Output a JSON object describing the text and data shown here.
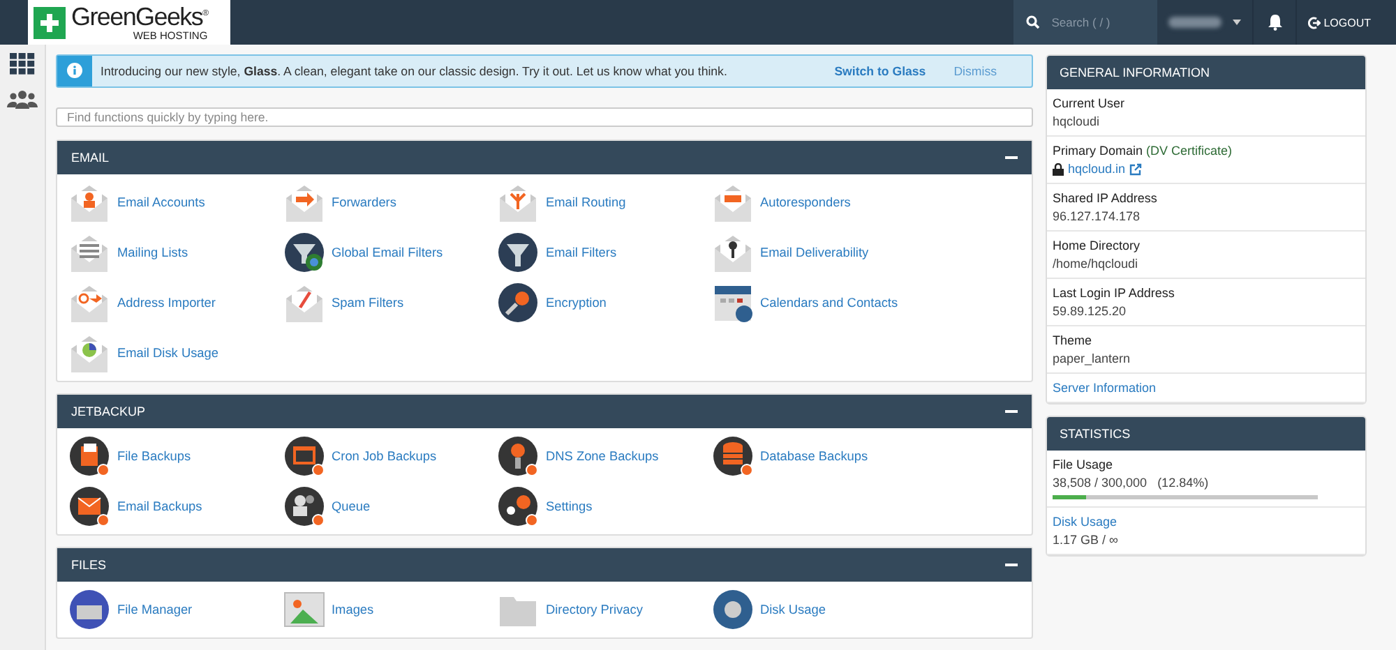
{
  "header": {
    "logo": {
      "name": "GreenGeeks",
      "mark": "®",
      "tagline": "WEB HOSTING"
    },
    "search": {
      "placeholder": "Search ( / )"
    },
    "logout": "LOGOUT"
  },
  "notice": {
    "text": "Introducing our new style, **Glass**. A clean, elegant take on our classic design. Try it out. Let us know what you think.",
    "action": "Switch to Glass",
    "dismiss": "Dismiss"
  },
  "quick_search": {
    "placeholder": "Find functions quickly by typing here."
  },
  "sections": [
    {
      "title": "EMAIL",
      "items": [
        "Email Accounts",
        "Forwarders",
        "Email Routing",
        "Autoresponders",
        "Mailing Lists",
        "Global Email Filters",
        "Email Filters",
        "Email Deliverability",
        "Address Importer",
        "Spam Filters",
        "Encryption",
        "Calendars and Contacts",
        "Email Disk Usage"
      ]
    },
    {
      "title": "JETBACKUP",
      "items": [
        "File Backups",
        "Cron Job Backups",
        "DNS Zone Backups",
        "Database Backups",
        "Email Backups",
        "Queue",
        "Settings"
      ]
    },
    {
      "title": "FILES",
      "items": [
        "File Manager",
        "Images",
        "Directory Privacy",
        "Disk Usage"
      ]
    }
  ],
  "general_information": {
    "title": "GENERAL INFORMATION",
    "rows": [
      {
        "label": "Current User",
        "value": "hqcloudi"
      },
      {
        "label": "Primary Domain",
        "note": "(DV Certificate)",
        "link": "hqcloud.in"
      },
      {
        "label": "Shared IP Address",
        "value": "96.127.174.178"
      },
      {
        "label": "Home Directory",
        "value": "/home/hqcloudi"
      },
      {
        "label": "Last Login IP Address",
        "value": "59.89.125.20"
      },
      {
        "label": "Theme",
        "value": "paper_lantern"
      }
    ],
    "footer_link": "Server Information"
  },
  "statistics": {
    "title": "STATISTICS",
    "rows": [
      {
        "label": "File Usage",
        "value": "38,508 / 300,000   (12.84%)",
        "level": 0.1284
      },
      {
        "label": "Disk Usage",
        "value": "1.17 GB / ∞"
      }
    ]
  }
}
